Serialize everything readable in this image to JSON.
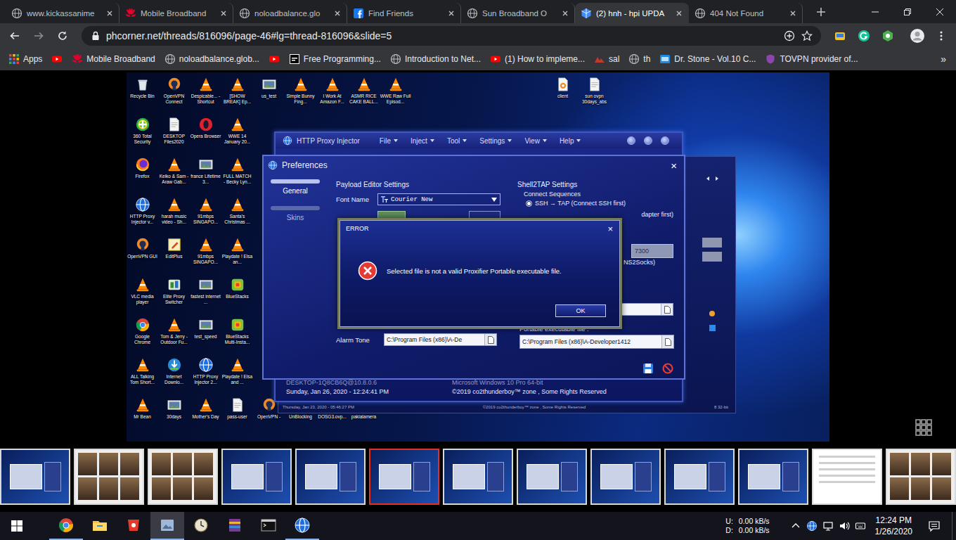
{
  "browser": {
    "tabs": [
      {
        "label": "www.kickassanime",
        "favicon": "globe",
        "selected": false
      },
      {
        "label": "Mobile Broadband",
        "favicon": "huawei",
        "selected": false
      },
      {
        "label": "noloadbalance.glo",
        "favicon": "globe",
        "selected": false
      },
      {
        "label": "Find Friends",
        "favicon": "facebook",
        "selected": false
      },
      {
        "label": "Sun Broadband O",
        "favicon": "globe",
        "selected": false
      },
      {
        "label": "(2) hnh - hpi UPDA",
        "favicon": "hpi",
        "selected": true
      },
      {
        "label": "404 Not Found",
        "favicon": "globe",
        "selected": false
      }
    ],
    "url": "phcorner.net/threads/816096/page-46#lg=thread-816096&slide=5",
    "bookmarks": [
      {
        "label": "Apps",
        "kind": "apps"
      },
      {
        "label": "",
        "kind": "youtube"
      },
      {
        "label": "Mobile Broadband",
        "kind": "huawei"
      },
      {
        "label": "noloadbalance.glob...",
        "kind": "globe"
      },
      {
        "label": "",
        "kind": "youtube"
      },
      {
        "label": "Free Programming...",
        "kind": "code"
      },
      {
        "label": "Introduction to Net...",
        "kind": "globe"
      },
      {
        "label": "(1) How to impleme...",
        "kind": "youtube"
      },
      {
        "label": "sal",
        "kind": "mountain"
      },
      {
        "label": "th",
        "kind": "globe"
      },
      {
        "label": "Dr. Stone - Vol.10 C...",
        "kind": "mr"
      },
      {
        "label": "TOVPN provider of...",
        "kind": "tovpn"
      }
    ],
    "bookmarks_more": "»"
  },
  "viewer": {
    "screenshot": {
      "desktop": {
        "columns": [
          [
            {
              "label": "Recycle Bin",
              "kind": "recycle"
            },
            {
              "label": "360 Total Security",
              "kind": "security"
            },
            {
              "label": "Firefox",
              "kind": "firefox"
            },
            {
              "label": "HTTP Proxy Injector v...",
              "kind": "hpi"
            },
            {
              "label": "OpenVPN GUI",
              "kind": "openvpn"
            },
            {
              "label": "VLC media player",
              "kind": "vlc"
            },
            {
              "label": "Google Chrome",
              "kind": "chrome"
            },
            {
              "label": "ALL Talking Tom Short...",
              "kind": "vlc"
            },
            {
              "label": "Mr Bean",
              "kind": "vlc"
            }
          ],
          [
            {
              "label": "OpenVPN Connect",
              "kind": "openvpn"
            },
            {
              "label": "DESKTOP Files2020",
              "kind": "doc"
            },
            {
              "label": "Keiko & Sam - Araw Gab...",
              "kind": "vlc"
            },
            {
              "label": "harah music video - Sh...",
              "kind": "vlc"
            },
            {
              "label": "EditPlus",
              "kind": "editplus"
            },
            {
              "label": "Elite Proxy Switcher",
              "kind": "proxy"
            },
            {
              "label": "Tom & Jerry - Outdoor Fu...",
              "kind": "vlc"
            },
            {
              "label": "Internet Downlo...",
              "kind": "idm"
            },
            {
              "label": "30days",
              "kind": "image"
            }
          ],
          [
            {
              "label": "Despicable... - Shortcut",
              "kind": "vlc"
            },
            {
              "label": "Opera Browser",
              "kind": "opera"
            },
            {
              "label": "france Lifetime 3...",
              "kind": "image"
            },
            {
              "label": "91mbps SINGAPO...",
              "kind": "vlc"
            },
            {
              "label": "91mbps SINGAPO...",
              "kind": "vlc"
            },
            {
              "label": "fastest internet ...",
              "kind": "image"
            },
            {
              "label": "test_speed",
              "kind": "image"
            },
            {
              "label": "HTTP Proxy Injector 2...",
              "kind": "hpi"
            },
            {
              "label": "Mother's Day",
              "kind": "vlc"
            }
          ],
          [
            {
              "label": "[SHOW BREAK] Ep...",
              "kind": "vlc"
            },
            {
              "label": "WWE 14 January 20...",
              "kind": "vlc"
            },
            {
              "label": "FULL MATCH - Becky Lyn...",
              "kind": "vlc"
            },
            {
              "label": "Santa's Christmas ...",
              "kind": "vlc"
            },
            {
              "label": "Playdate ! Elsa an...",
              "kind": "vlc"
            },
            {
              "label": "BlueStacks",
              "kind": "bluestacks"
            },
            {
              "label": "BlueStacks Multi-Insta...",
              "kind": "bluestacks"
            },
            {
              "label": "Playdate ! Elsa and ...",
              "kind": "vlc"
            },
            {
              "label": "pass-user",
              "kind": "doc"
            }
          ],
          [
            {
              "label": "us_test",
              "kind": "image"
            },
            {
              "label": "",
              "kind": "empty"
            },
            {
              "label": "",
              "kind": "empty"
            },
            {
              "label": "",
              "kind": "empty"
            },
            {
              "label": "",
              "kind": "empty"
            },
            {
              "label": "",
              "kind": "empty"
            },
            {
              "label": "",
              "kind": "empty"
            },
            {
              "label": "",
              "kind": "empty"
            },
            {
              "label": "OpenVPN -",
              "kind": "openvpn"
            }
          ],
          [
            {
              "label": "Simple Bunny Fing...",
              "kind": "vlc"
            },
            {
              "label": "",
              "kind": "empty"
            },
            {
              "label": "",
              "kind": "empty"
            },
            {
              "label": "",
              "kind": "empty"
            },
            {
              "label": "",
              "kind": "empty"
            },
            {
              "label": "",
              "kind": "empty"
            },
            {
              "label": "",
              "kind": "empty"
            },
            {
              "label": "",
              "kind": "empty"
            },
            {
              "label": "UnBlocking",
              "kind": "doc"
            }
          ],
          [
            {
              "label": "I Work At Amazon F...",
              "kind": "vlc"
            },
            {
              "label": "",
              "kind": "empty"
            },
            {
              "label": "",
              "kind": "empty"
            },
            {
              "label": "",
              "kind": "empty"
            },
            {
              "label": "",
              "kind": "empty"
            },
            {
              "label": "",
              "kind": "empty"
            },
            {
              "label": "",
              "kind": "empty"
            },
            {
              "label": "",
              "kind": "empty"
            },
            {
              "label": "DOSG3.ovp...",
              "kind": "doc"
            }
          ],
          [
            {
              "label": "ASMR RICE CAKE BALL...",
              "kind": "vlc"
            },
            {
              "label": "",
              "kind": "empty"
            },
            {
              "label": "",
              "kind": "empty"
            },
            {
              "label": "",
              "kind": "empty"
            },
            {
              "label": "",
              "kind": "empty"
            },
            {
              "label": "",
              "kind": "empty"
            },
            {
              "label": "",
              "kind": "empty"
            },
            {
              "label": "",
              "kind": "empty"
            },
            {
              "label": "pakialamera",
              "kind": "image"
            }
          ],
          [
            {
              "label": "WWE Raw Full Episod...",
              "kind": "vlc"
            }
          ]
        ],
        "right_icons": [
          {
            "label": "client",
            "kind": "ovpnfile"
          },
          {
            "label": "sun ovpn 30days_abs",
            "kind": "doc"
          }
        ]
      },
      "back_window": {
        "footer_date": "Thursday, Jan 23, 2020 - 05:46:27 PM",
        "footer_copyright": "©2019 co2thunderboy™ zone , Some Rights Reserved",
        "footer_os": "8 32-bit"
      },
      "main_window": {
        "title": "HTTP Proxy Injector",
        "menus": [
          "File",
          "Inject",
          "Tool",
          "Settings",
          "View",
          "Help"
        ],
        "host": "DESKTOP-1Q8CB6Q@10.8.0.6",
        "date": "Sunday, Jan 26, 2020 - 12:24:41 PM",
        "os": "Microsoft Windows 10 Pro 64-bit",
        "copyright": "©2019 co2thunderboy™ zone , Some Rights Reserved"
      },
      "preferences": {
        "title": "Preferences",
        "close": "×",
        "sidebar": [
          {
            "label": "General",
            "selected": true
          },
          {
            "label": "Skins",
            "selected": false
          }
        ],
        "payload_heading": "Payload Editor Settings",
        "font_label": "Font Name",
        "font_value": "Courier New",
        "alarm_label": "Alarm Tone",
        "alarm_value": "C:\\Program Files (x86)\\A-De",
        "shell_heading": "Shell2TAP Settings",
        "sequence_label": "Connect Sequences",
        "sequences": [
          {
            "label": "SSH → TAP (Connect SSH first)",
            "selected": true
          }
        ],
        "sequence_partial": "dapter first)",
        "port_value": "7300",
        "socks_partial": "NS2Socks)",
        "proxifier_label": "Portable executable file :",
        "proxifier_value": "C:\\Program Files (x86)\\A-Developer1412"
      },
      "error": {
        "title": "ERROR",
        "close": "×",
        "message": "Selected file is not a valid Proxifier Portable executable file.",
        "button": "OK"
      }
    },
    "thumbnails": [
      {
        "kind": "desktop",
        "selected": false
      },
      {
        "kind": "gallery",
        "selected": false
      },
      {
        "kind": "gallery",
        "selected": false
      },
      {
        "kind": "desktop",
        "selected": false
      },
      {
        "kind": "desktop",
        "selected": false
      },
      {
        "kind": "desktop",
        "selected": true
      },
      {
        "kind": "desktop",
        "selected": false
      },
      {
        "kind": "desktop",
        "selected": false
      },
      {
        "kind": "desktop",
        "selected": false
      },
      {
        "kind": "desktop",
        "selected": false
      },
      {
        "kind": "desktop",
        "selected": false
      },
      {
        "kind": "page",
        "selected": false
      },
      {
        "kind": "gallery",
        "selected": false
      }
    ]
  },
  "taskbar": {
    "apps": [
      {
        "kind": "chrome",
        "running": true,
        "active": false
      },
      {
        "kind": "explorer",
        "running": false,
        "active": false
      },
      {
        "kind": "garena",
        "running": false,
        "active": false
      },
      {
        "kind": "photos",
        "running": true,
        "active": true
      },
      {
        "kind": "clock",
        "running": false,
        "active": false
      },
      {
        "kind": "winrar",
        "running": false,
        "active": false
      },
      {
        "kind": "cmd",
        "running": false,
        "active": false
      },
      {
        "kind": "hpi",
        "running": true,
        "active": false
      }
    ],
    "network": [
      {
        "label": "U:",
        "value": "0.00 kB/s"
      },
      {
        "label": "D:",
        "value": "0.00 kB/s"
      }
    ],
    "time": "12:24 PM",
    "date": "1/26/2020"
  }
}
